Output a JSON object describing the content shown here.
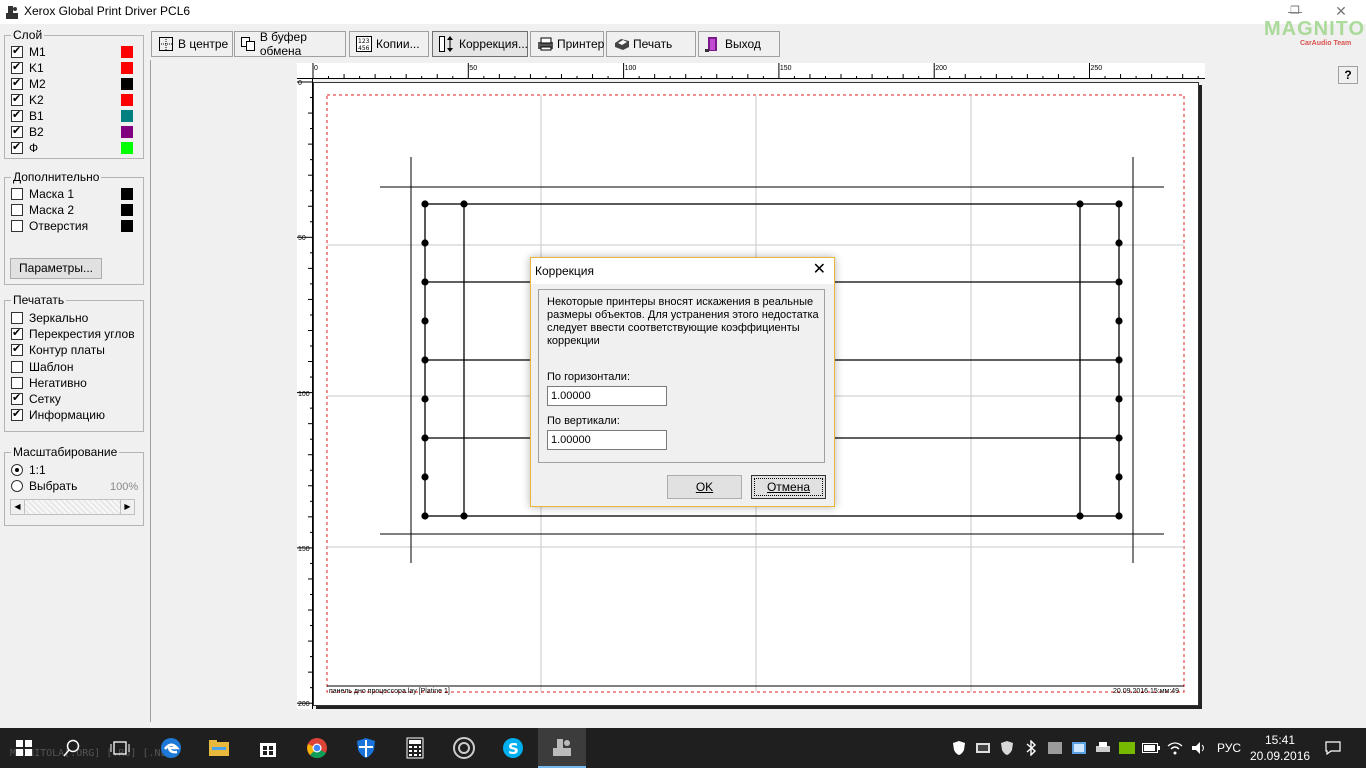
{
  "window": {
    "title": "Xerox Global Print Driver PCL6",
    "watermark_logo": "MAGNITOLA",
    "watermark_sub": "CarAudio Team"
  },
  "layers": {
    "legend": "Слой",
    "items": [
      {
        "label": "M1",
        "checked": true,
        "color": "#ff0000"
      },
      {
        "label": "K1",
        "checked": true,
        "color": "#ff0000"
      },
      {
        "label": "M2",
        "checked": true,
        "color": "#000000"
      },
      {
        "label": "K2",
        "checked": true,
        "color": "#ff0000"
      },
      {
        "label": "B1",
        "checked": true,
        "color": "#008080"
      },
      {
        "label": "B2",
        "checked": true,
        "color": "#800080"
      },
      {
        "label": "Ф",
        "checked": true,
        "color": "#00ff00"
      }
    ]
  },
  "extra": {
    "legend": "Дополнительно",
    "items": [
      {
        "label": "Маска 1",
        "checked": false,
        "color": "#000000"
      },
      {
        "label": "Маска 2",
        "checked": false,
        "color": "#000000"
      },
      {
        "label": "Отверстия",
        "checked": false,
        "color": "#000000"
      }
    ],
    "params_button": "Параметры..."
  },
  "print": {
    "legend": "Печатать",
    "items": [
      {
        "label": "Зеркально",
        "checked": false
      },
      {
        "label": "Перекрестия углов",
        "checked": true
      },
      {
        "label": "Контур платы",
        "checked": true
      },
      {
        "label": "Шаблон",
        "checked": false
      },
      {
        "label": "Негативно",
        "checked": false
      },
      {
        "label": "Сетку",
        "checked": true
      },
      {
        "label": "Информацию",
        "checked": true
      }
    ]
  },
  "scale": {
    "legend": "Масштабирование",
    "option_1": "1:1",
    "option_2": "Выбрать",
    "percent": "100%",
    "arrow_left": "◀",
    "arrow_right": "▶"
  },
  "toolbar": {
    "center": "В центре",
    "clipboard": "В буфер обмена",
    "copies": "Копии...",
    "correction": "Коррекция...",
    "printer": "Принтер",
    "print": "Печать",
    "exit": "Выход",
    "help": "?"
  },
  "ruler": {
    "top": [
      "0",
      "50",
      "100",
      "150",
      "200",
      "250"
    ],
    "left": [
      "0",
      "50",
      "100",
      "150",
      "200"
    ]
  },
  "sheet": {
    "footer_left": "панель дно процессора.lay [Platine 1]",
    "footer_right": "20.09.2016 15:мм:49"
  },
  "dialog": {
    "title": "Коррекция",
    "close": "✕",
    "description": "Некоторые принтеры вносят искажения в реальные размеры объектов. Для устранения этого недостатка следует ввести соответствующие коэффициенты коррекции",
    "horizontal_label": "По горизонтали:",
    "horizontal_value": "1.00000",
    "vertical_label": "По вертикали:",
    "vertical_value": "1.00000",
    "ok": "OK",
    "cancel": "Отмена"
  },
  "taskbar": {
    "watermark": "MAGNITOLA[.ORG] [.RU] [.NET]",
    "lang": "РУС",
    "time": "15:41",
    "date": "20.09.2016"
  }
}
